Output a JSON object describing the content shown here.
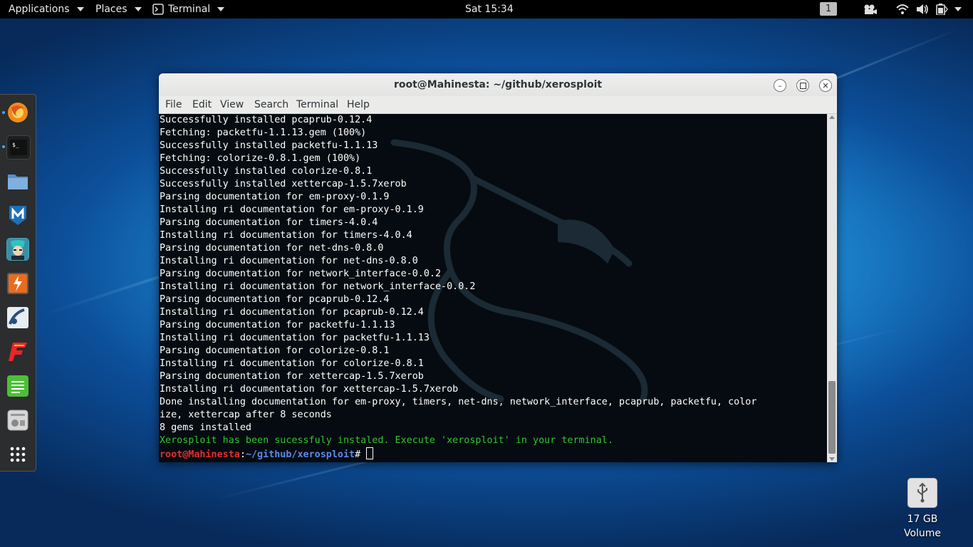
{
  "topbar": {
    "applications": "Applications",
    "places": "Places",
    "terminal": "Terminal",
    "clock": "Sat 15:34",
    "workspace": "1"
  },
  "tray_icons": [
    "video-icon",
    "wifi-icon",
    "volume-icon",
    "battery-icon"
  ],
  "dock": {
    "items": [
      "firefox-icon",
      "terminal-icon",
      "files-icon",
      "metasploit-icon",
      "armitage-icon",
      "burpsuite-icon",
      "beef-icon",
      "faraday-icon",
      "leafpad-icon",
      "settings-icon",
      "app-grid-icon"
    ]
  },
  "window": {
    "title": "root@Mahinesta: ~/github/xerosploit",
    "menu": [
      "File",
      "Edit",
      "View",
      "Search",
      "Terminal",
      "Help"
    ]
  },
  "terminal": {
    "lines": [
      "Successfully installed pcaprub-0.12.4",
      "Fetching: packetfu-1.1.13.gem (100%)",
      "Successfully installed packetfu-1.1.13",
      "Fetching: colorize-0.8.1.gem (100%)",
      "Successfully installed colorize-0.8.1",
      "Successfully installed xettercap-1.5.7xerob",
      "Parsing documentation for em-proxy-0.1.9",
      "Installing ri documentation for em-proxy-0.1.9",
      "Parsing documentation for timers-4.0.4",
      "Installing ri documentation for timers-4.0.4",
      "Parsing documentation for net-dns-0.8.0",
      "Installing ri documentation for net-dns-0.8.0",
      "Parsing documentation for network_interface-0.0.2",
      "Installing ri documentation for network_interface-0.0.2",
      "Parsing documentation for pcaprub-0.12.4",
      "Installing ri documentation for pcaprub-0.12.4",
      "Parsing documentation for packetfu-1.1.13",
      "Installing ri documentation for packetfu-1.1.13",
      "Parsing documentation for colorize-0.8.1",
      "Installing ri documentation for colorize-0.8.1",
      "Parsing documentation for xettercap-1.5.7xerob",
      "Installing ri documentation for xettercap-1.5.7xerob",
      "Done installing documentation for em-proxy, timers, net-dns, network_interface, pcaprub, packetfu, color",
      "ize, xettercap after 8 seconds",
      "8 gems installed"
    ],
    "success_message": "Xerosploit has been sucessfuly instaled. Execute 'xerosploit' in your terminal.",
    "prompt_user": "root@Mahinesta",
    "prompt_sep": ":",
    "prompt_path": "~/github/xerosploit",
    "prompt_symbol": "# ",
    "scroll_thumb_fraction": 0.22
  },
  "volume": {
    "size": "17 GB",
    "label": "Volume"
  }
}
